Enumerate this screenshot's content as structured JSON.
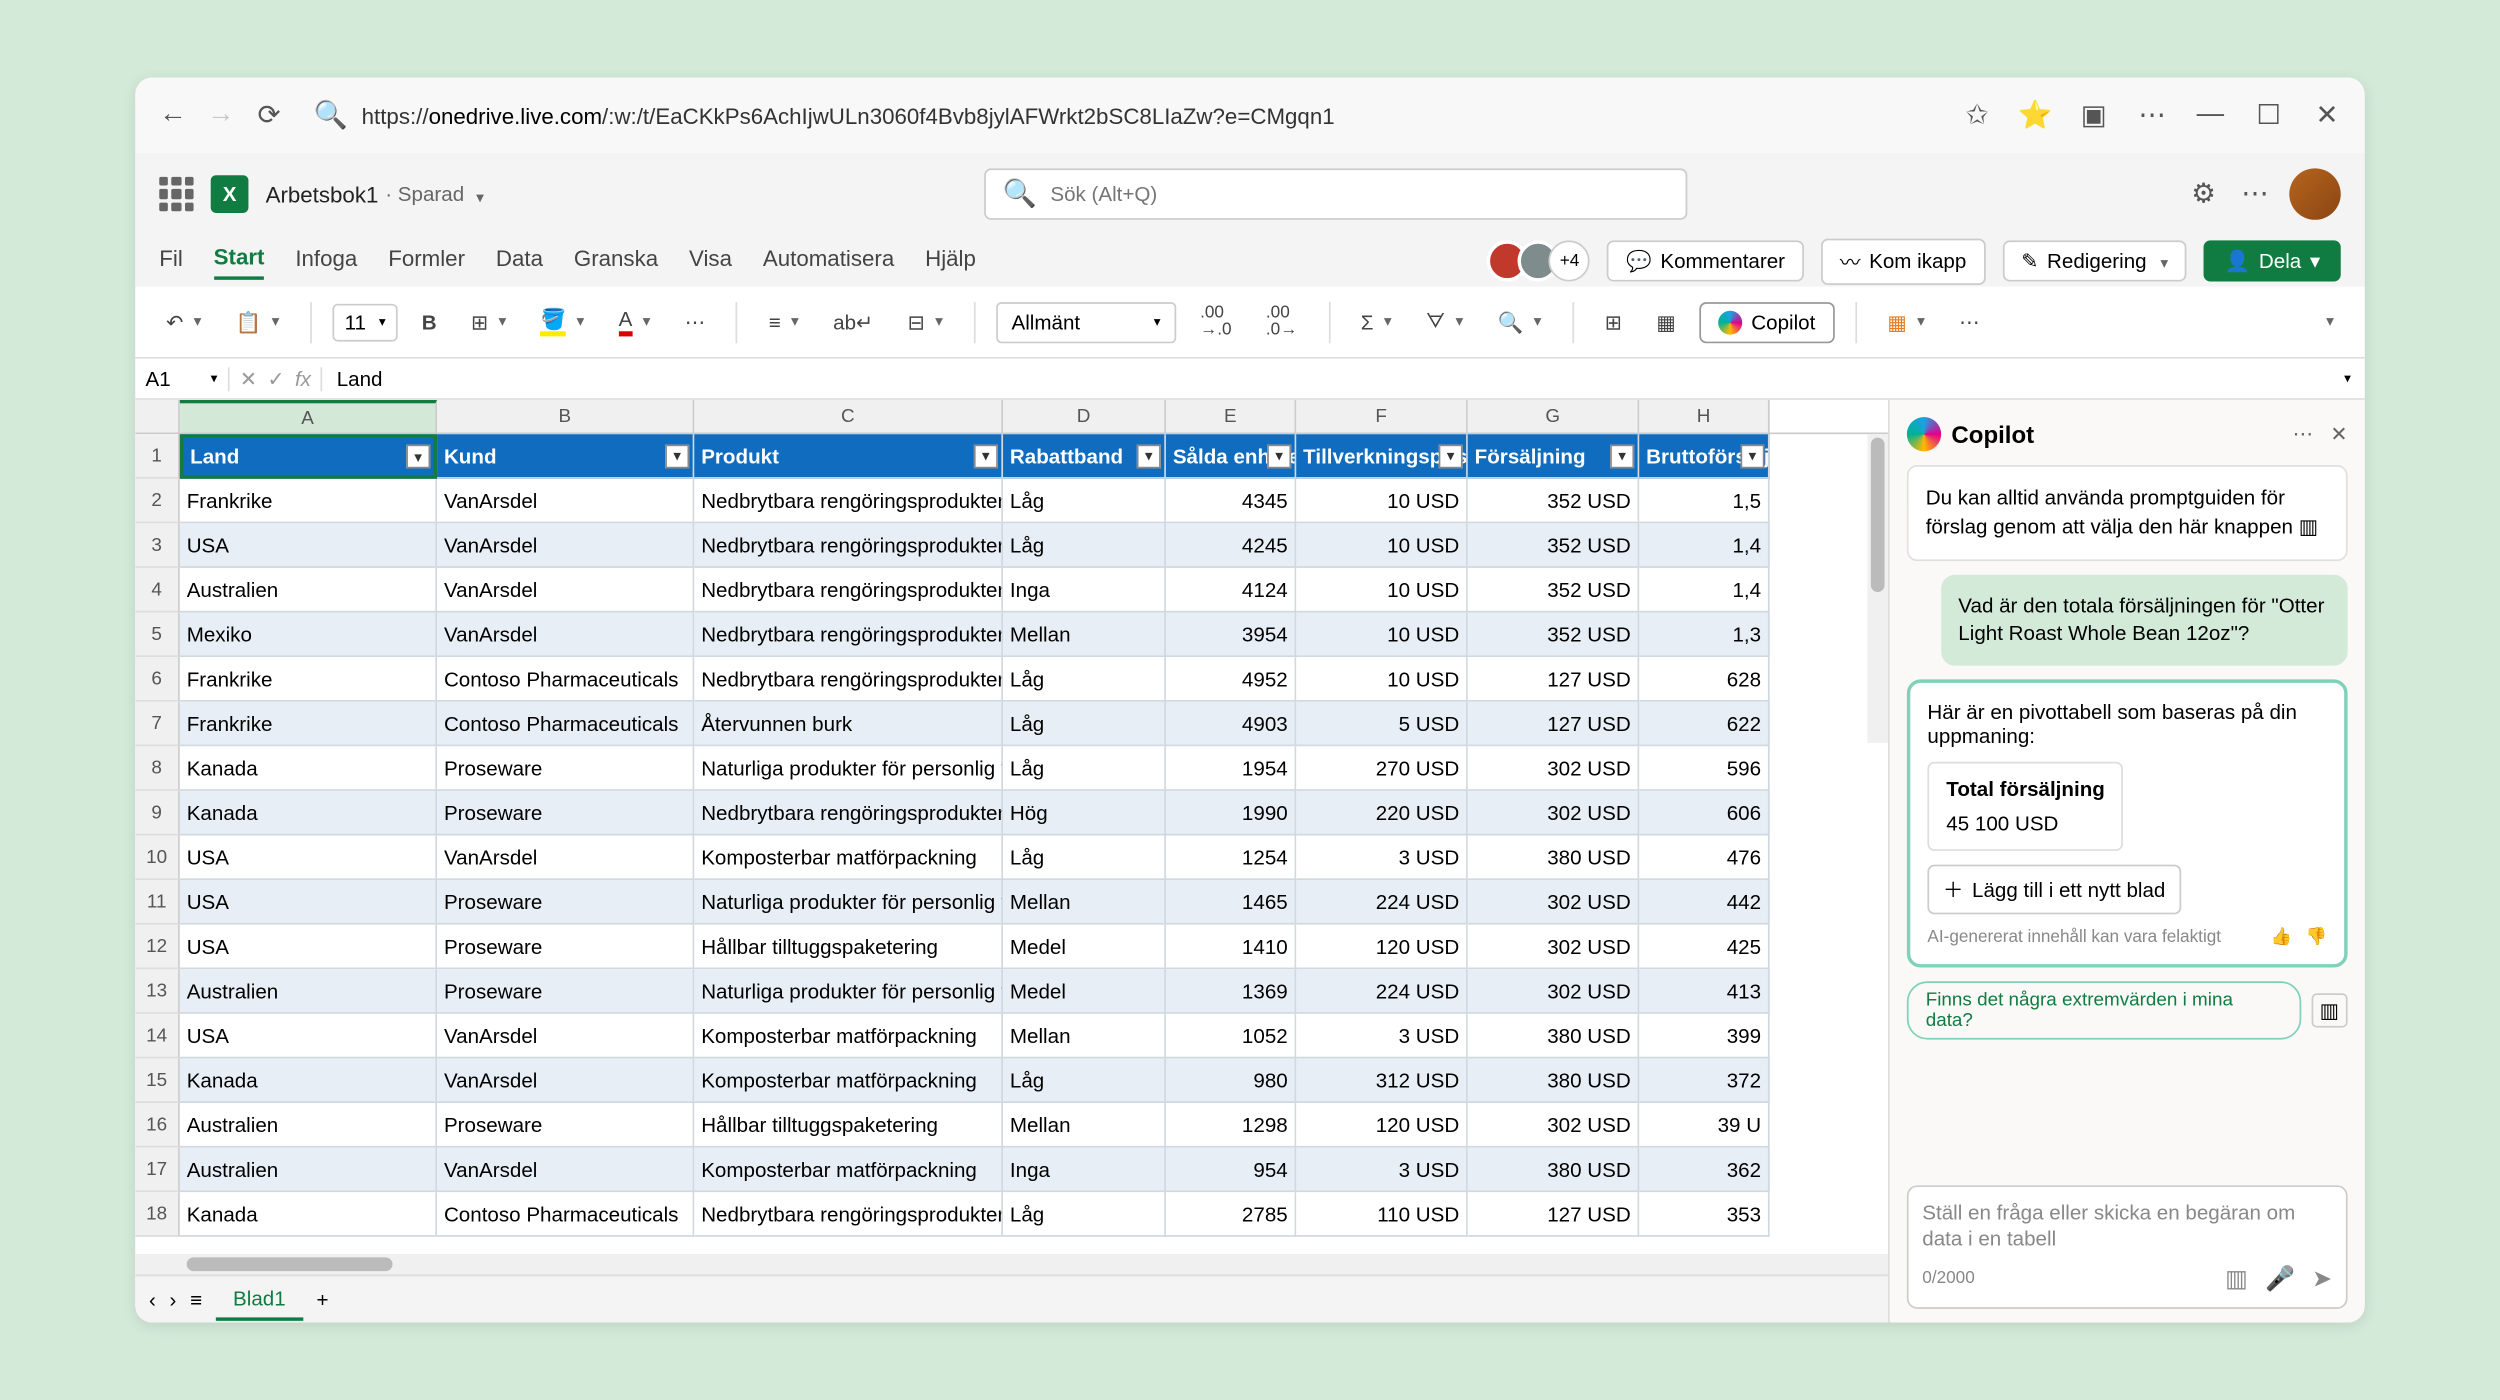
{
  "browser": {
    "url_host": "onedrive.live.com",
    "url_path": "/:w:/t/EaCKkPs6AchIjwULn3060f4Bvb8jylAFWrkt2bSC8LIaZw?e=CMgqn1"
  },
  "header": {
    "doc_name": "Arbetsbok1",
    "saved": "· Sparad",
    "search_placeholder": "Sök (Alt+Q)"
  },
  "tabs": {
    "items": [
      "Fil",
      "Start",
      "Infoga",
      "Formler",
      "Data",
      "Granska",
      "Visa",
      "Automatisera",
      "Hjälp"
    ],
    "active": 1,
    "extra_faces": "+4",
    "comments": "Kommentarer",
    "catchup": "Kom ikapp",
    "editing": "Redigering",
    "share": "Dela"
  },
  "ribbon": {
    "font_size": "11",
    "num_format": "Allmänt",
    "copilot": "Copilot"
  },
  "formula_bar": {
    "cell_ref": "A1",
    "value": "Land"
  },
  "columns": [
    "A",
    "B",
    "C",
    "D",
    "E",
    "F",
    "G",
    "H"
  ],
  "headers": [
    "Land",
    "Kund",
    "Produkt",
    "Rabattband",
    "Sålda enheter",
    "Tillverkningspris",
    "Försäljning",
    "Bruttoförsäljning"
  ],
  "rows": [
    {
      "n": 2,
      "c": [
        "Frankrike",
        "VanArsdel",
        "Nedbrytbara rengöringsprodukter",
        "Låg",
        "4345",
        "10 USD",
        "352 USD",
        "1,5"
      ]
    },
    {
      "n": 3,
      "c": [
        "USA",
        "VanArsdel",
        "Nedbrytbara rengöringsprodukter",
        "Låg",
        "4245",
        "10 USD",
        "352 USD",
        "1,4"
      ]
    },
    {
      "n": 4,
      "c": [
        "Australien",
        "VanArsdel",
        "Nedbrytbara rengöringsprodukter",
        "Inga",
        "4124",
        "10 USD",
        "352 USD",
        "1,4"
      ]
    },
    {
      "n": 5,
      "c": [
        "Mexiko",
        "VanArsdel",
        "Nedbrytbara rengöringsprodukter",
        "Mellan",
        "3954",
        "10 USD",
        "352 USD",
        "1,3"
      ]
    },
    {
      "n": 6,
      "c": [
        "Frankrike",
        "Contoso Pharmaceuticals",
        "Nedbrytbara rengöringsprodukter",
        "Låg",
        "4952",
        "10 USD",
        "127 USD",
        "628"
      ]
    },
    {
      "n": 7,
      "c": [
        "Frankrike",
        "Contoso Pharmaceuticals",
        "Återvunnen burk",
        "Låg",
        "4903",
        "5 USD",
        "127 USD",
        "622"
      ]
    },
    {
      "n": 8,
      "c": [
        "Kanada",
        "Proseware",
        "Naturliga produkter för personlig vård",
        "Låg",
        "1954",
        "270 USD",
        "302 USD",
        "596"
      ]
    },
    {
      "n": 9,
      "c": [
        "Kanada",
        "Proseware",
        "Nedbrytbara rengöringsprodukter",
        "Hög",
        "1990",
        "220 USD",
        "302 USD",
        "606"
      ]
    },
    {
      "n": 10,
      "c": [
        "USA",
        "VanArsdel",
        "Komposterbar matförpackning",
        "Låg",
        "1254",
        "3 USD",
        "380 USD",
        "476"
      ]
    },
    {
      "n": 11,
      "c": [
        "USA",
        "Proseware",
        "Naturliga produkter för personlig vård",
        "Mellan",
        "1465",
        "224 USD",
        "302 USD",
        "442"
      ]
    },
    {
      "n": 12,
      "c": [
        "USA",
        "Proseware",
        "Hållbar tilltuggspaketering",
        "Medel",
        "1410",
        "120 USD",
        "302 USD",
        "425"
      ]
    },
    {
      "n": 13,
      "c": [
        "Australien",
        "Proseware",
        "Naturliga produkter för personlig vård",
        "Medel",
        "1369",
        "224 USD",
        "302 USD",
        "413"
      ]
    },
    {
      "n": 14,
      "c": [
        "USA",
        "VanArsdel",
        "Komposterbar matförpackning",
        "Mellan",
        "1052",
        "3 USD",
        "380 USD",
        "399"
      ]
    },
    {
      "n": 15,
      "c": [
        "Kanada",
        "VanArsdel",
        "Komposterbar matförpackning",
        "Låg",
        "980",
        "312 USD",
        "380 USD",
        "372"
      ]
    },
    {
      "n": 16,
      "c": [
        "Australien",
        "Proseware",
        "Hållbar tilltuggspaketering",
        "Mellan",
        "1298",
        "120 USD",
        "302 USD",
        "39 U"
      ]
    },
    {
      "n": 17,
      "c": [
        "Australien",
        "VanArsdel",
        "Komposterbar matförpackning",
        "Inga",
        "954",
        "3 USD",
        "380 USD",
        "362"
      ]
    },
    {
      "n": 18,
      "c": [
        "Kanada",
        "Contoso Pharmaceuticals",
        "Nedbrytbara rengöringsprodukter",
        "Låg",
        "2785",
        "110 USD",
        "127 USD",
        "353"
      ]
    }
  ],
  "sheet_tab": "Blad1",
  "copilot": {
    "title": "Copilot",
    "hint": "Du kan alltid använda promptguiden för förslag genom att välja den här knappen",
    "user_msg": "Vad är den totala försäljningen för \"Otter Light Roast Whole Bean 12oz\"?",
    "resp_intro": "Här är en pivottabell som baseras på din uppmaning:",
    "pivot_header": "Total försäljning",
    "pivot_value": "45 100 USD",
    "add_btn": "Lägg till i ett nytt blad",
    "disclaimer": "AI-genererat innehåll kan vara felaktigt",
    "suggestion": "Finns det några extremvärden i mina data?",
    "input_placeholder": "Ställ en fråga eller skicka en begäran om data i en tabell",
    "char_count": "0/2000"
  }
}
